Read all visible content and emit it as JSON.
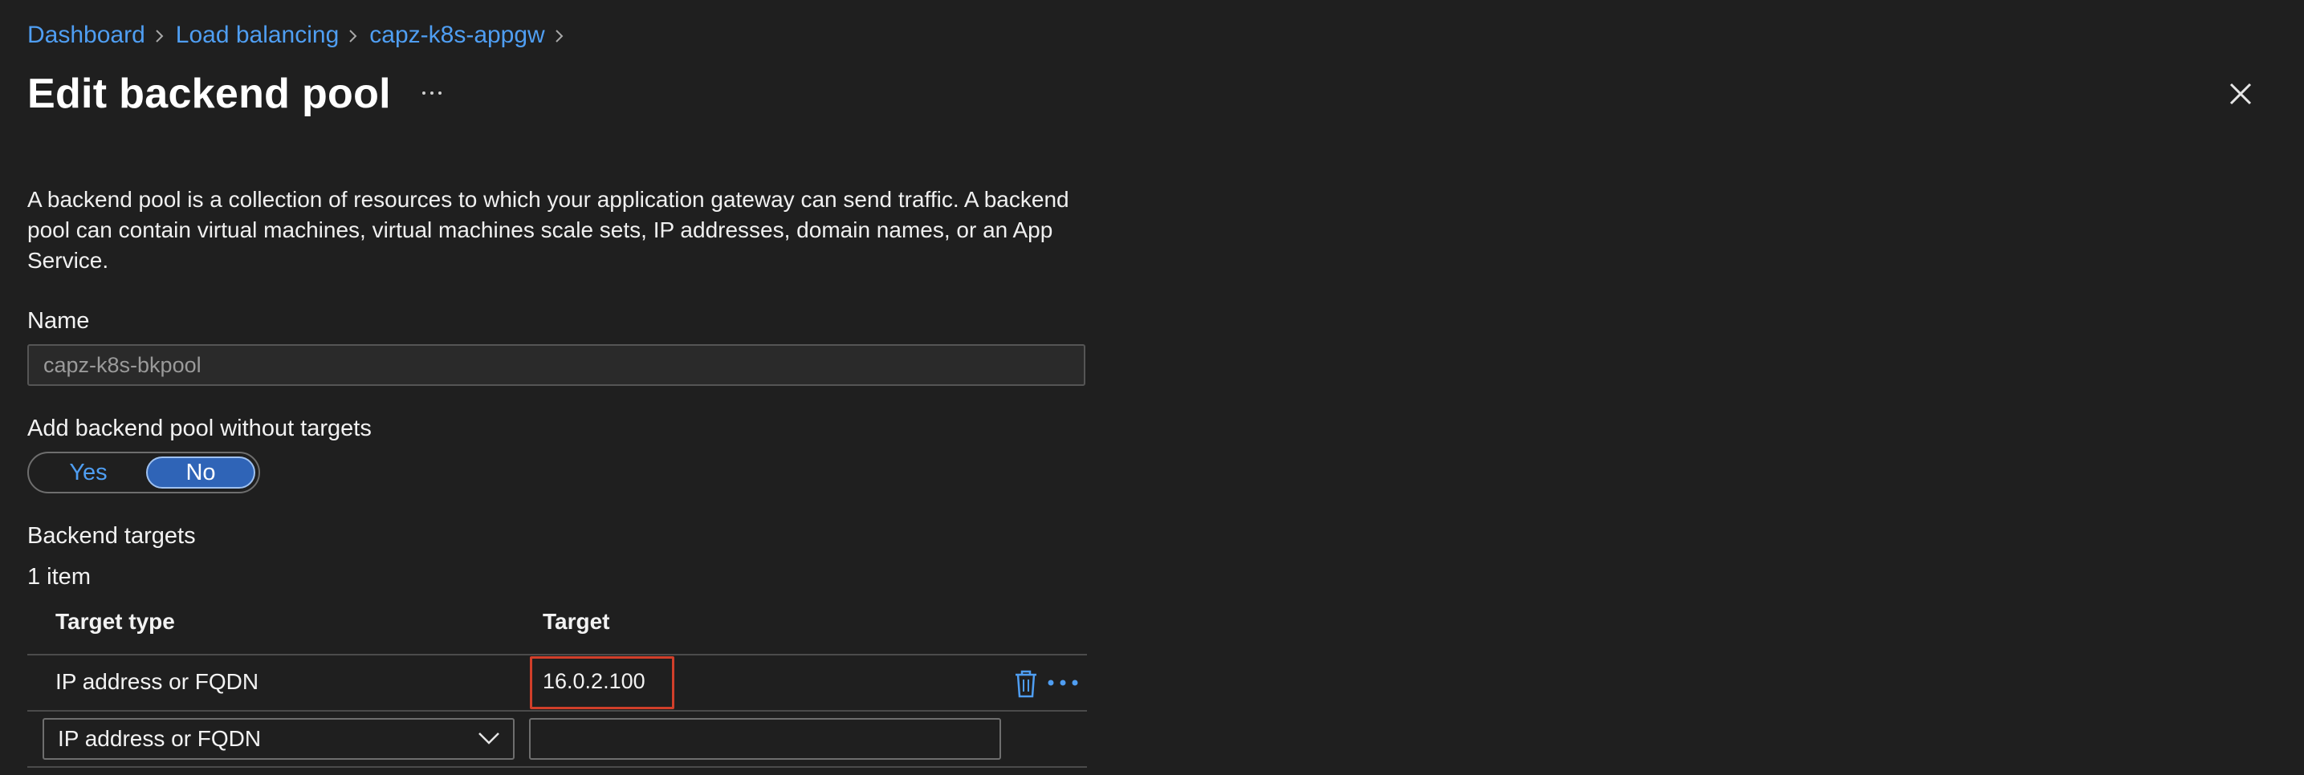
{
  "breadcrumb": {
    "items": [
      "Dashboard",
      "Load balancing",
      "capz-k8s-appgw"
    ]
  },
  "header": {
    "title": "Edit backend pool",
    "more_icon": "ellipsis-icon",
    "close_icon": "close-icon"
  },
  "description": "A backend pool is a collection of resources to which your application gateway can send traffic. A backend pool can contain virtual machines, virtual machines scale sets, IP addresses, domain names, or an App Service.",
  "name_field": {
    "label": "Name",
    "value": "capz-k8s-bkpool"
  },
  "targets_toggle": {
    "label": "Add backend pool without targets",
    "options": [
      "Yes",
      "No"
    ],
    "selected": "No"
  },
  "backend_targets": {
    "label": "Backend targets",
    "count": "1 item",
    "columns": [
      "Target type",
      "Target"
    ],
    "rows": [
      {
        "target_type": "IP address or FQDN",
        "target": "16.0.2.100"
      }
    ],
    "new_row": {
      "target_type": "IP address or FQDN",
      "target": ""
    }
  },
  "colors": {
    "background": "#1f1f1f",
    "link": "#4f9ef2",
    "toggle_selected": "#2f64b7",
    "highlight": "#d13f2a"
  }
}
